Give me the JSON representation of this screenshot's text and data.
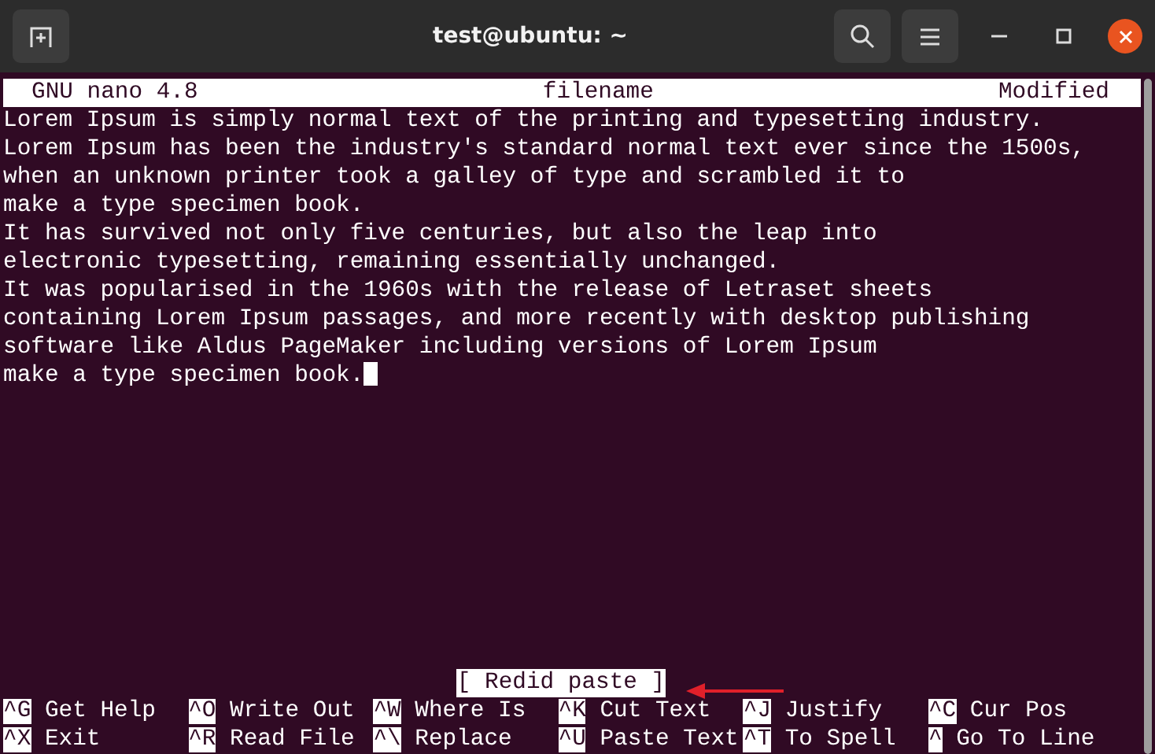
{
  "window": {
    "title": "test@ubuntu: ~"
  },
  "nano": {
    "version_label": "GNU nano 4.8",
    "filename": "filename",
    "state_label": "Modified",
    "lines": [
      "Lorem Ipsum is simply normal text of the printing and typesetting industry.",
      "Lorem Ipsum has been the industry's standard normal text ever since the 1500s,",
      "when an unknown printer took a galley of type and scrambled it to",
      "make a type specimen book.",
      "It has survived not only five centuries, but also the leap into",
      "electronic typesetting, remaining essentially unchanged.",
      "It was popularised in the 1960s with the release of Letraset sheets",
      "containing Lorem Ipsum passages, and more recently with desktop publishing",
      "software like Aldus PageMaker including versions of Lorem Ipsum",
      "make a type specimen book."
    ],
    "cursor_at_end": true,
    "status": "[ Redid paste ]",
    "shortcut_rows": [
      [
        {
          "key": "^G",
          "label": "Get Help"
        },
        {
          "key": "^O",
          "label": "Write Out"
        },
        {
          "key": "^W",
          "label": "Where Is"
        },
        {
          "key": "^K",
          "label": "Cut Text"
        },
        {
          "key": "^J",
          "label": "Justify"
        },
        {
          "key": "^C",
          "label": "Cur Pos"
        }
      ],
      [
        {
          "key": "^X",
          "label": "Exit"
        },
        {
          "key": "^R",
          "label": "Read File"
        },
        {
          "key": "^\\",
          "label": "Replace"
        },
        {
          "key": "^U",
          "label": "Paste Text"
        },
        {
          "key": "^T",
          "label": "To Spell"
        },
        {
          "key": "^",
          "label": "Go To Line"
        }
      ]
    ]
  }
}
